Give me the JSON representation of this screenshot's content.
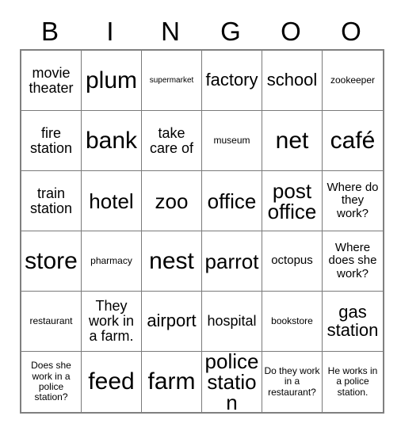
{
  "card": {
    "header_letters": [
      "B",
      "I",
      "N",
      "G",
      "O",
      "O"
    ],
    "columns": 6,
    "rows": 6,
    "border_color": "#808080",
    "grid_line_color": "#7a7a7a",
    "text_color": "#000000",
    "background_color": "#ffffff",
    "cells": [
      {
        "text": "movie theater",
        "size": "md"
      },
      {
        "text": "plum",
        "size": "xxl"
      },
      {
        "text": "supermarket",
        "size": "xxs"
      },
      {
        "text": "factory",
        "size": "lg"
      },
      {
        "text": "school",
        "size": "lg"
      },
      {
        "text": "zookeeper",
        "size": "xs"
      },
      {
        "text": "fire station",
        "size": "md"
      },
      {
        "text": "bank",
        "size": "xxl"
      },
      {
        "text": "take care of",
        "size": "md"
      },
      {
        "text": "museum",
        "size": "xs"
      },
      {
        "text": "net",
        "size": "xxl"
      },
      {
        "text": "café",
        "size": "xxl"
      },
      {
        "text": "train station",
        "size": "md"
      },
      {
        "text": "hotel",
        "size": "xl"
      },
      {
        "text": "zoo",
        "size": "xl"
      },
      {
        "text": "office",
        "size": "xl"
      },
      {
        "text": "post office",
        "size": "xl"
      },
      {
        "text": "Where do they work?",
        "size": "sm"
      },
      {
        "text": "store",
        "size": "xxl"
      },
      {
        "text": "pharmacy",
        "size": "xs"
      },
      {
        "text": "nest",
        "size": "xxl"
      },
      {
        "text": "parrot",
        "size": "xl"
      },
      {
        "text": "octopus",
        "size": "sm"
      },
      {
        "text": "Where does she work?",
        "size": "sm"
      },
      {
        "text": "restaurant",
        "size": "xs"
      },
      {
        "text": "They work in a farm.",
        "size": "md"
      },
      {
        "text": "airport",
        "size": "lg"
      },
      {
        "text": "hospital",
        "size": "md"
      },
      {
        "text": "bookstore",
        "size": "xs"
      },
      {
        "text": "gas station",
        "size": "lg"
      },
      {
        "text": "Does she work in a police station?",
        "size": "xs"
      },
      {
        "text": "feed",
        "size": "xxl"
      },
      {
        "text": "farm",
        "size": "xxl"
      },
      {
        "text": "police station",
        "size": "xl"
      },
      {
        "text": "Do they work in a restaurant?",
        "size": "xs"
      },
      {
        "text": "He works in a police station.",
        "size": "xs"
      }
    ]
  }
}
